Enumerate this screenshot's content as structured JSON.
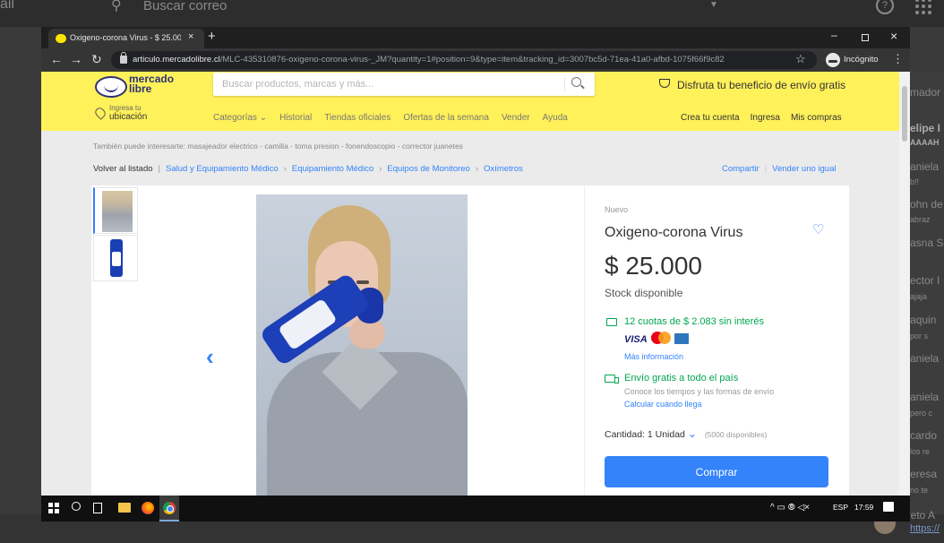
{
  "background": {
    "app": "ail",
    "search_placeholder": "Buscar correo",
    "help": "?",
    "right_items": [
      "mador",
      "elipe I",
      "AAAAH",
      "aniela",
      "b!!",
      "ohn de",
      "abraz",
      "asna S",
      "ector I",
      "ajaja",
      "aquin",
      "por s",
      "aniela",
      "aniela",
      "pero c",
      "cardo",
      "los re",
      "eresa",
      "no te"
    ],
    "bottom_name": "oreto A",
    "bottom_link": "https://"
  },
  "browser": {
    "tab_title": "Oxigeno-corona Virus - $ 25.000",
    "tab_close": "×",
    "new_tab": "+",
    "url_domain": "articulo.mercadolibre.cl",
    "url_path": "/MLC-435310876-oxigeno-corona-virus-_JM?quantity=1#position=9&type=item&tracking_id=3007bc5d-71ea-41a0-afbd-1075f66f9c82",
    "incognito": "Incógnito",
    "min": "–",
    "close": "×"
  },
  "header": {
    "logo_line1": "mercado",
    "logo_line2": "libre",
    "search_placeholder": "Buscar productos, marcas y más...",
    "promo": "Disfruta tu beneficio de envío gratis",
    "location_line1": "Ingresa tu",
    "location_line2": "ubicación",
    "categories": [
      "Categorías ⌄",
      "Historial",
      "Tiendas oficiales",
      "Ofertas de la semana",
      "Vender",
      "Ayuda"
    ],
    "account": [
      "Crea tu cuenta",
      "Ingresa",
      "Mis compras"
    ]
  },
  "related": "También puede interesarte: masajeador electrico - camilla - toma presion - fonendoscopio - corrector juanetes",
  "breadcrumb": {
    "back": "Volver al listado",
    "items": [
      "Salud y Equipamiento Médico",
      "Equipamiento Médico",
      "Equipos de Monitoreo",
      "Oxímetros"
    ],
    "share": "Compartir",
    "sell": "Vender uno igual"
  },
  "product": {
    "condition": "Nuevo",
    "title": "Oxigeno-corona Virus",
    "price": "$ 25.000",
    "stock": "Stock disponible",
    "installments": "12 cuotas de $ 2.083 sin interés",
    "visa": "VISA",
    "more_info": "Más información",
    "shipping": "Envío gratis a todo el país",
    "shipping_sub": "Conoce los tiempos y las formas de envío",
    "calc": "Calcular cuándo llega",
    "quantity": "Cantidad: 1 Unidad",
    "available": "(5000 disponibles)",
    "buy": "Comprar"
  },
  "taskbar": {
    "tray": "^ ▭ ⦾ ◁×",
    "lang": "ESP",
    "time": "17:59"
  },
  "colors": {
    "ml_yellow": "#fff159",
    "ml_blue": "#3483fa",
    "green": "#00a650"
  }
}
